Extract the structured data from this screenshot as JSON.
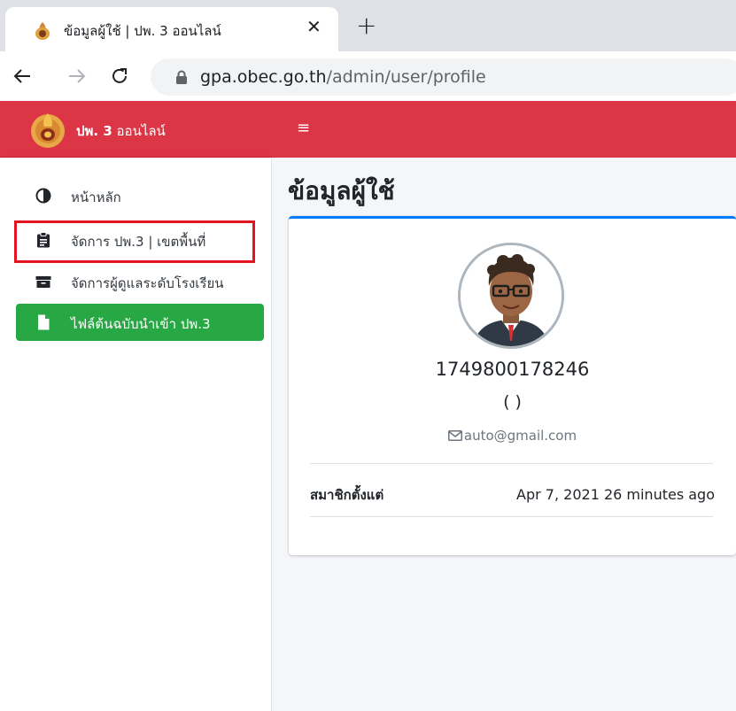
{
  "browser": {
    "tab_title": "ข้อมูลผู้ใช้ | ปพ. 3 ออนไลน์",
    "close_glyph": "✕",
    "new_tab_glyph": "+",
    "url_host": "gpa.obec.go.th",
    "url_path": "/admin/user/profile"
  },
  "app": {
    "brand_bold": "ปพ. 3",
    "brand_rest": " ออนไลน์",
    "hamburger_glyph": "≡",
    "accent_color": "#dc3545",
    "active_color": "#28a745",
    "card_top_color": "#007bff"
  },
  "sidebar": {
    "items": [
      {
        "label": "หน้าหลัก",
        "icon": "adjust-icon"
      },
      {
        "label": "จัดการ ปพ.3 | เขตพื้นที่",
        "icon": "clipboard-icon"
      },
      {
        "label": "จัดการผู้ดูแลระดับโรงเรียน",
        "icon": "archive-icon"
      },
      {
        "label": "ไฟล์ต้นฉบับนำเข้า ปพ.3",
        "icon": "file-icon",
        "active": true
      }
    ]
  },
  "main": {
    "page_title": "ข้อมูลผู้ใช้",
    "profile": {
      "username": "1749800178246",
      "subtitle": "( )",
      "email": "auto@gmail.com",
      "member_since_label": "สมาชิกตั้งแต่",
      "member_since_value": "Apr 7, 2021 26 minutes ago"
    }
  }
}
